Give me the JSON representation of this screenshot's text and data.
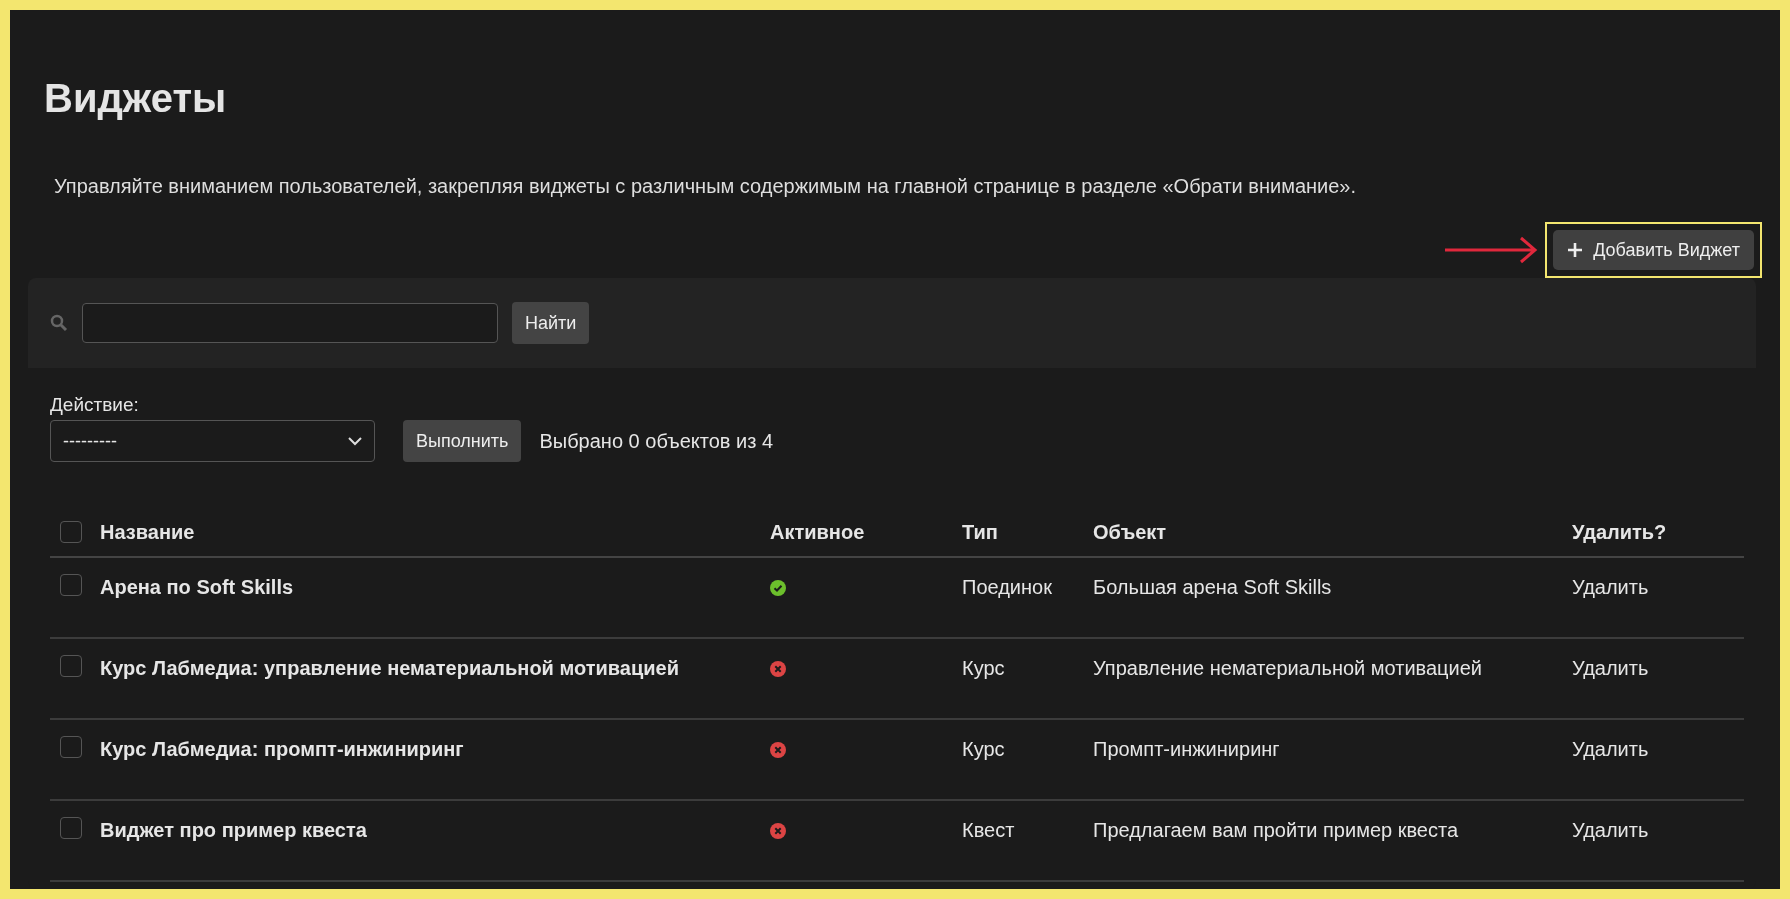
{
  "page": {
    "title": "Виджеты",
    "description": "Управляйте вниманием пользователей, закрепляя виджеты с различным содержимым на главной странице в разделе «Обрати внимание»."
  },
  "add_button": {
    "label": "Добавить Виджет",
    "highlighted": true
  },
  "search": {
    "button": "Найти"
  },
  "actions": {
    "label": "Действие:",
    "select_value": "---------",
    "run_button": "Выполнить",
    "selection_info": "Выбрано 0 объектов из 4"
  },
  "table": {
    "select_all_checked": false,
    "columns": [
      "Название",
      "Активное",
      "Тип",
      "Объект",
      "Удалить?"
    ],
    "rows": [
      {
        "name": "Арена по Soft Skills",
        "active": true,
        "type": "Поединок",
        "object": "Большая арена Soft Skills",
        "delete": "Удалить",
        "checked": false
      },
      {
        "name": "Курс Лабмедиа: управление нематериальной мотивацией",
        "active": false,
        "type": "Курс",
        "object": "Управление нематериальной мотивацией",
        "delete": "Удалить",
        "checked": false
      },
      {
        "name": "Курс Лабмедиа: промпт-инжиниринг",
        "active": false,
        "type": "Курс",
        "object": "Промпт-инжиниринг",
        "delete": "Удалить",
        "checked": false
      },
      {
        "name": "Виджет про пример квеста",
        "active": false,
        "type": "Квест",
        "object": "Предлагаем вам пройти пример квеста",
        "delete": "Удалить",
        "checked": false
      }
    ]
  }
}
